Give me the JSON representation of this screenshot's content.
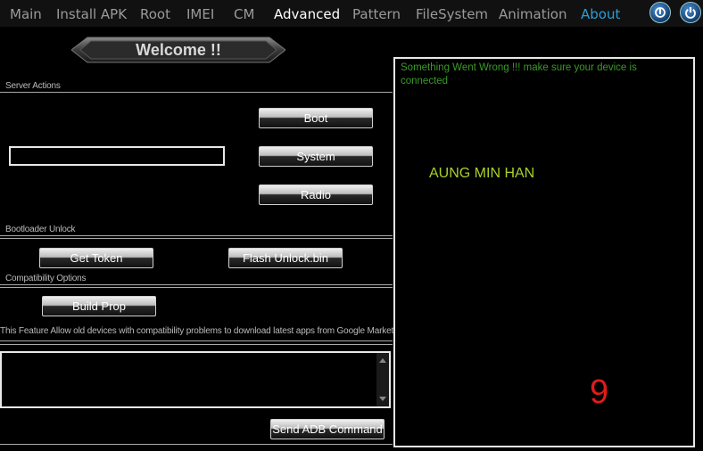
{
  "tabs": [
    {
      "label": "Main"
    },
    {
      "label": "Install APK"
    },
    {
      "label": "Root"
    },
    {
      "label": "IMEI"
    },
    {
      "label": "CM"
    },
    {
      "label": "Advanced",
      "active": true
    },
    {
      "label": "Pattern"
    },
    {
      "label": "FileSystem"
    },
    {
      "label": "Animation"
    },
    {
      "label": "About"
    }
  ],
  "header_buttons": {
    "left_icon": "power-toggle-icon",
    "right_icon": "power-icon"
  },
  "welcome": {
    "title": "Welcome !!"
  },
  "sections": {
    "server_actions": "Server Actions",
    "bootloader_unlock": "Bootloader Unlock",
    "compatibility_options": "Compatibility Options"
  },
  "server_actions": {
    "input_value": "",
    "boot_label": "Boot",
    "system_label": "System",
    "radio_label": "Radio"
  },
  "bootloader": {
    "get_token_label": "Get Token",
    "flash_unlock_label": "Flash Unlock.bin"
  },
  "compatibility": {
    "build_prop_label": "Build Prop",
    "note": "This Feature Allow old devices with compatibility problems to download latest apps from Google Markets"
  },
  "adb": {
    "command_value": "",
    "send_label": "Send ADB Command"
  },
  "log": {
    "message": "Something Went Wrong !!! make sure your device is connected",
    "name": "AUNG MIN HAN",
    "count": "9"
  },
  "colors": {
    "accent_link": "#2a9fd8",
    "log_message": "#3a9a28",
    "log_name": "#a8d02a",
    "log_count": "#e01b1b"
  }
}
